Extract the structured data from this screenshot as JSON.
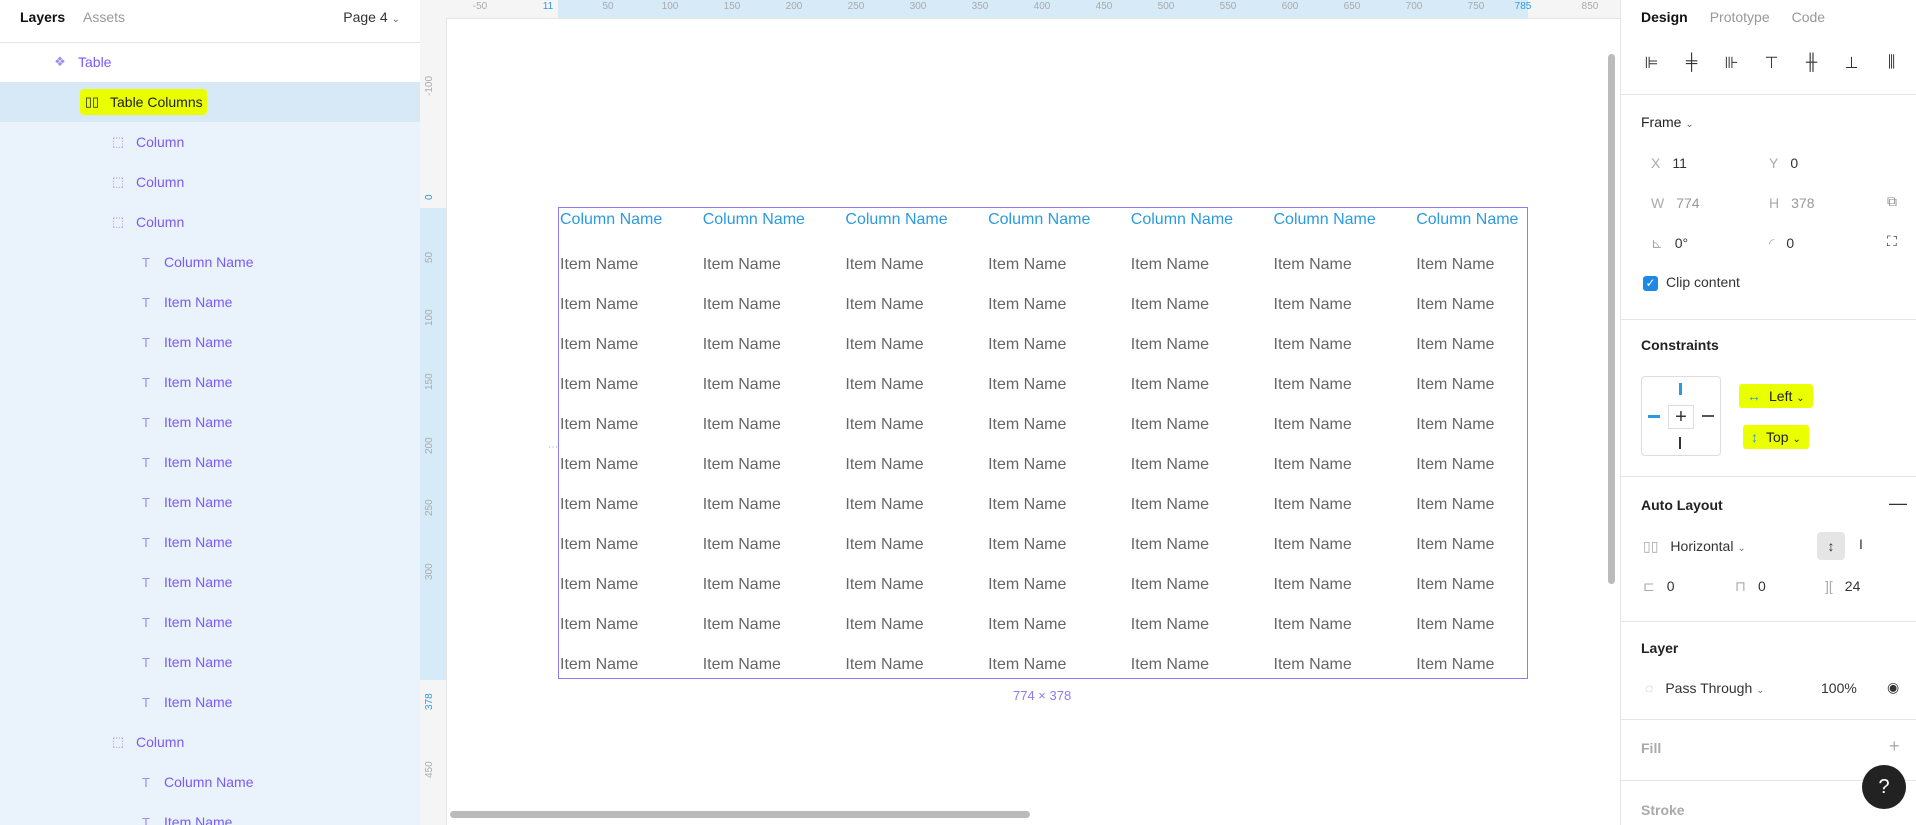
{
  "left_panel": {
    "tabs": {
      "layers": "Layers",
      "assets": "Assets"
    },
    "page_selector": "Page 4",
    "layers": [
      {
        "label": "Table",
        "type": "component",
        "indent": 0
      },
      {
        "label": "Table Columns",
        "type": "auto-layout",
        "indent": 1,
        "selected": true,
        "highlighted": true
      },
      {
        "label": "Column",
        "type": "frame",
        "indent": 2
      },
      {
        "label": "Column",
        "type": "frame",
        "indent": 2
      },
      {
        "label": "Column",
        "type": "frame",
        "indent": 2
      },
      {
        "label": "Column Name",
        "type": "text",
        "indent": 3
      },
      {
        "label": "Item Name",
        "type": "text",
        "indent": 3
      },
      {
        "label": "Item Name",
        "type": "text",
        "indent": 3
      },
      {
        "label": "Item Name",
        "type": "text",
        "indent": 3
      },
      {
        "label": "Item Name",
        "type": "text",
        "indent": 3
      },
      {
        "label": "Item Name",
        "type": "text",
        "indent": 3
      },
      {
        "label": "Item Name",
        "type": "text",
        "indent": 3
      },
      {
        "label": "Item Name",
        "type": "text",
        "indent": 3
      },
      {
        "label": "Item Name",
        "type": "text",
        "indent": 3
      },
      {
        "label": "Item Name",
        "type": "text",
        "indent": 3
      },
      {
        "label": "Item Name",
        "type": "text",
        "indent": 3
      },
      {
        "label": "Item Name",
        "type": "text",
        "indent": 3
      },
      {
        "label": "Column",
        "type": "frame",
        "indent": 2
      },
      {
        "label": "Column Name",
        "type": "text",
        "indent": 3
      },
      {
        "label": "Item Name",
        "type": "text",
        "indent": 3
      }
    ]
  },
  "canvas": {
    "ruler_top": [
      "-50",
      "11",
      "50",
      "100",
      "150",
      "200",
      "250",
      "300",
      "350",
      "400",
      "450",
      "500",
      "550",
      "600",
      "650",
      "700",
      "750",
      "785",
      "850"
    ],
    "ruler_left": [
      "-100",
      "0",
      "50",
      "100",
      "150",
      "200",
      "250",
      "300",
      "378",
      "450"
    ],
    "table": {
      "column_header": "Column Name",
      "item_label": "Item Name",
      "columns": 7,
      "rows": 11
    },
    "frame_size_label": "774 × 378"
  },
  "right_panel": {
    "tabs": {
      "design": "Design",
      "prototype": "Prototype",
      "code": "Code"
    },
    "frame": {
      "title": "Frame",
      "x_label": "X",
      "x": "11",
      "y_label": "Y",
      "y": "0",
      "w_label": "W",
      "w": "774",
      "h_label": "H",
      "h": "378",
      "rotation": "0°",
      "radius": "0",
      "clip_content": "Clip content"
    },
    "constraints": {
      "title": "Constraints",
      "horizontal": "Left",
      "vertical": "Top"
    },
    "auto_layout": {
      "title": "Auto Layout",
      "direction": "Horizontal",
      "padding_h": "0",
      "padding_v": "0",
      "spacing": "24"
    },
    "layer": {
      "title": "Layer",
      "blend": "Pass Through",
      "opacity": "100%"
    },
    "fill": {
      "title": "Fill"
    },
    "stroke": {
      "title": "Stroke"
    }
  },
  "colors": {
    "selection": "#d7e8f7",
    "highlight": "#eaff00",
    "accent": "#2c9ae0",
    "purple": "#8c7bf7"
  }
}
